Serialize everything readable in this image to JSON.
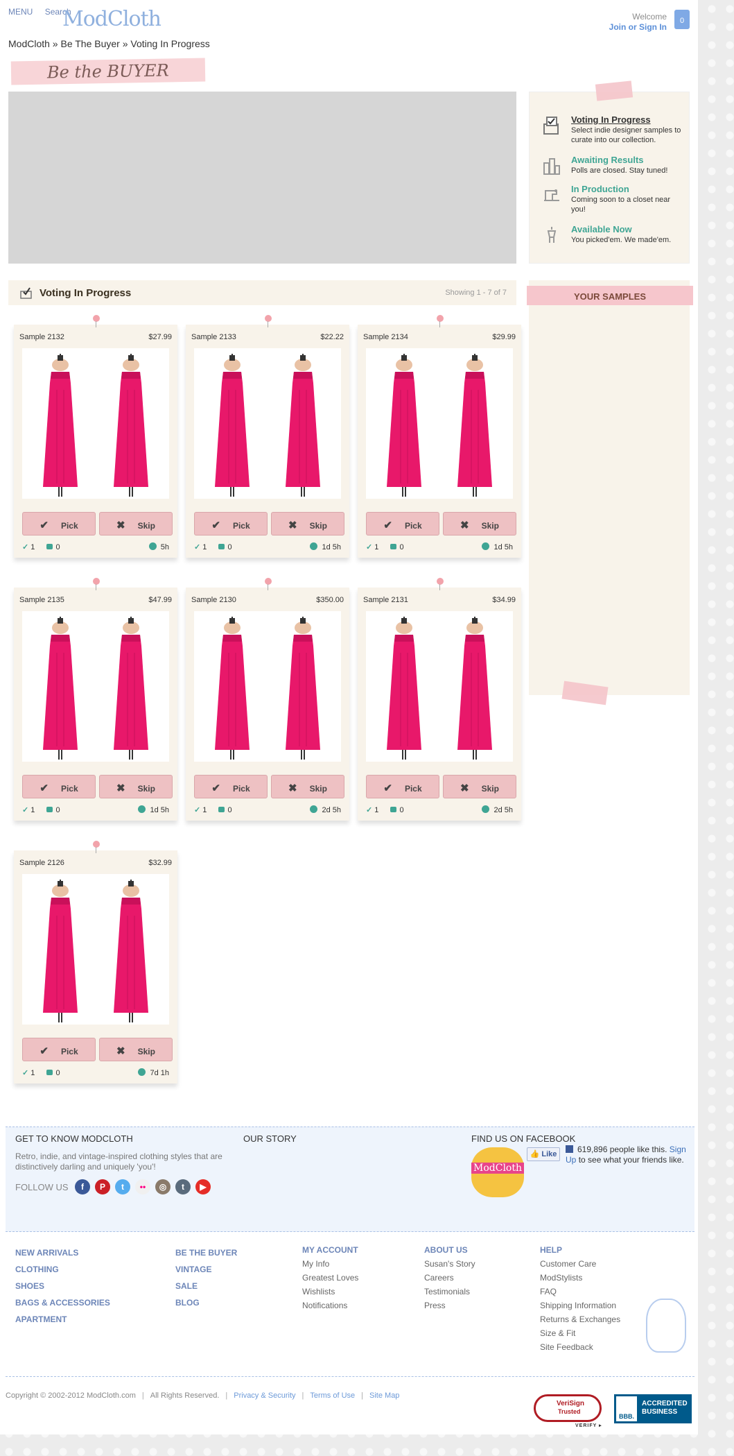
{
  "header": {
    "menu": "MENU",
    "search": "Search",
    "logo": "ModCloth",
    "welcome": "Welcome",
    "join": "Join or Sign In",
    "bag_count": "0"
  },
  "breadcrumb": "ModCloth » Be The Buyer » Voting In Progress",
  "banner": "Be the BUYER",
  "status": [
    {
      "title": "Voting In Progress",
      "desc": "Select indie designer samples to curate into our collection."
    },
    {
      "title": "Awaiting Results",
      "desc": "Polls are closed. Stay tuned!"
    },
    {
      "title": "In Production",
      "desc": "Coming soon to a closet near you!"
    },
    {
      "title": "Available Now",
      "desc": "You picked'em. We made'em."
    }
  ],
  "voting": {
    "title": "Voting In Progress",
    "showing": "Showing 1 - 7 of 7"
  },
  "your_samples": "YOUR SAMPLES",
  "buttons": {
    "pick": "Pick",
    "skip": "Skip"
  },
  "samples": [
    {
      "name": "Sample 2132",
      "price": "$27.99",
      "picks": "1",
      "comments": "0",
      "time": "5h"
    },
    {
      "name": "Sample 2133",
      "price": "$22.22",
      "picks": "1",
      "comments": "0",
      "time": "1d 5h"
    },
    {
      "name": "Sample 2134",
      "price": "$29.99",
      "picks": "1",
      "comments": "0",
      "time": "1d 5h"
    },
    {
      "name": "Sample 2135",
      "price": "$47.99",
      "picks": "1",
      "comments": "0",
      "time": "1d 5h"
    },
    {
      "name": "Sample 2130",
      "price": "$350.00",
      "picks": "1",
      "comments": "0",
      "time": "2d 5h"
    },
    {
      "name": "Sample 2131",
      "price": "$34.99",
      "picks": "1",
      "comments": "0",
      "time": "2d 5h"
    },
    {
      "name": "Sample 2126",
      "price": "$32.99",
      "picks": "1",
      "comments": "0",
      "time": "7d 1h"
    }
  ],
  "footer": {
    "know_title": "GET TO KNOW MODCLOTH",
    "know_desc": "Retro, indie, and vintage-inspired clothing styles that are distinctively darling and uniquely 'you'!",
    "follow": "FOLLOW US",
    "story": "OUR STORY",
    "fb_title": "FIND US ON FACEBOOK",
    "fb_logo": "ModCloth",
    "fb_like": "Like",
    "fb_count": "619,896 people like this.",
    "fb_signup": "Sign Up",
    "fb_rest": "to see what your friends like.",
    "categories_1": [
      "NEW ARRIVALS",
      "CLOTHING",
      "SHOES",
      "BAGS & ACCESSORIES",
      "APARTMENT"
    ],
    "categories_2": [
      "BE THE BUYER",
      "VINTAGE",
      "SALE",
      "BLOG"
    ],
    "account": {
      "title": "MY ACCOUNT",
      "links": [
        "My Info",
        "Greatest Loves",
        "Wishlists",
        "Notifications"
      ]
    },
    "about": {
      "title": "ABOUT US",
      "links": [
        "Susan's Story",
        "Careers",
        "Testimonials",
        "Press"
      ]
    },
    "help": {
      "title": "HELP",
      "links": [
        "Customer Care",
        "ModStylists",
        "FAQ",
        "Shipping Information",
        "Returns & Exchanges",
        "Size & Fit",
        "Site Feedback"
      ]
    },
    "copyright": "Copyright © 2002-2012 ModCloth.com",
    "rights": "All Rights Reserved.",
    "privacy": "Privacy & Security",
    "terms": "Terms of Use",
    "sitemap": "Site Map",
    "verisign_1": "VeriSign",
    "verisign_2": "Trusted",
    "verify": "VERIFY ▸",
    "bbb_logo": "BBB.",
    "bbb_1": "ACCREDITED",
    "bbb_2": "BUSINESS"
  },
  "colors": {
    "accent": "#3fa594",
    "pink": "#eec1c3",
    "dress": "#e8186a",
    "link": "#6d86b8"
  }
}
